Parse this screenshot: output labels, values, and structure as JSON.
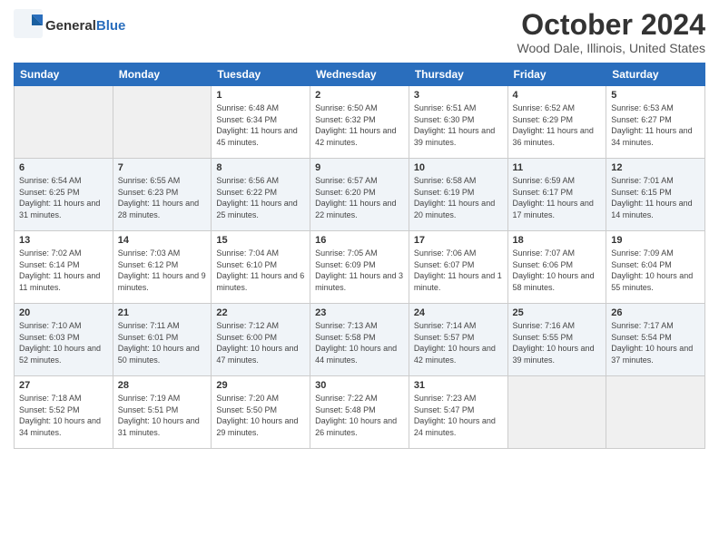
{
  "header": {
    "logo_general": "General",
    "logo_blue": "Blue",
    "month_title": "October 2024",
    "location": "Wood Dale, Illinois, United States"
  },
  "weekdays": [
    "Sunday",
    "Monday",
    "Tuesday",
    "Wednesday",
    "Thursday",
    "Friday",
    "Saturday"
  ],
  "weeks": [
    [
      {
        "day": "",
        "info": ""
      },
      {
        "day": "",
        "info": ""
      },
      {
        "day": "1",
        "info": "Sunrise: 6:48 AM\nSunset: 6:34 PM\nDaylight: 11 hours and 45 minutes."
      },
      {
        "day": "2",
        "info": "Sunrise: 6:50 AM\nSunset: 6:32 PM\nDaylight: 11 hours and 42 minutes."
      },
      {
        "day": "3",
        "info": "Sunrise: 6:51 AM\nSunset: 6:30 PM\nDaylight: 11 hours and 39 minutes."
      },
      {
        "day": "4",
        "info": "Sunrise: 6:52 AM\nSunset: 6:29 PM\nDaylight: 11 hours and 36 minutes."
      },
      {
        "day": "5",
        "info": "Sunrise: 6:53 AM\nSunset: 6:27 PM\nDaylight: 11 hours and 34 minutes."
      }
    ],
    [
      {
        "day": "6",
        "info": "Sunrise: 6:54 AM\nSunset: 6:25 PM\nDaylight: 11 hours and 31 minutes."
      },
      {
        "day": "7",
        "info": "Sunrise: 6:55 AM\nSunset: 6:23 PM\nDaylight: 11 hours and 28 minutes."
      },
      {
        "day": "8",
        "info": "Sunrise: 6:56 AM\nSunset: 6:22 PM\nDaylight: 11 hours and 25 minutes."
      },
      {
        "day": "9",
        "info": "Sunrise: 6:57 AM\nSunset: 6:20 PM\nDaylight: 11 hours and 22 minutes."
      },
      {
        "day": "10",
        "info": "Sunrise: 6:58 AM\nSunset: 6:19 PM\nDaylight: 11 hours and 20 minutes."
      },
      {
        "day": "11",
        "info": "Sunrise: 6:59 AM\nSunset: 6:17 PM\nDaylight: 11 hours and 17 minutes."
      },
      {
        "day": "12",
        "info": "Sunrise: 7:01 AM\nSunset: 6:15 PM\nDaylight: 11 hours and 14 minutes."
      }
    ],
    [
      {
        "day": "13",
        "info": "Sunrise: 7:02 AM\nSunset: 6:14 PM\nDaylight: 11 hours and 11 minutes."
      },
      {
        "day": "14",
        "info": "Sunrise: 7:03 AM\nSunset: 6:12 PM\nDaylight: 11 hours and 9 minutes."
      },
      {
        "day": "15",
        "info": "Sunrise: 7:04 AM\nSunset: 6:10 PM\nDaylight: 11 hours and 6 minutes."
      },
      {
        "day": "16",
        "info": "Sunrise: 7:05 AM\nSunset: 6:09 PM\nDaylight: 11 hours and 3 minutes."
      },
      {
        "day": "17",
        "info": "Sunrise: 7:06 AM\nSunset: 6:07 PM\nDaylight: 11 hours and 1 minute."
      },
      {
        "day": "18",
        "info": "Sunrise: 7:07 AM\nSunset: 6:06 PM\nDaylight: 10 hours and 58 minutes."
      },
      {
        "day": "19",
        "info": "Sunrise: 7:09 AM\nSunset: 6:04 PM\nDaylight: 10 hours and 55 minutes."
      }
    ],
    [
      {
        "day": "20",
        "info": "Sunrise: 7:10 AM\nSunset: 6:03 PM\nDaylight: 10 hours and 52 minutes."
      },
      {
        "day": "21",
        "info": "Sunrise: 7:11 AM\nSunset: 6:01 PM\nDaylight: 10 hours and 50 minutes."
      },
      {
        "day": "22",
        "info": "Sunrise: 7:12 AM\nSunset: 6:00 PM\nDaylight: 10 hours and 47 minutes."
      },
      {
        "day": "23",
        "info": "Sunrise: 7:13 AM\nSunset: 5:58 PM\nDaylight: 10 hours and 44 minutes."
      },
      {
        "day": "24",
        "info": "Sunrise: 7:14 AM\nSunset: 5:57 PM\nDaylight: 10 hours and 42 minutes."
      },
      {
        "day": "25",
        "info": "Sunrise: 7:16 AM\nSunset: 5:55 PM\nDaylight: 10 hours and 39 minutes."
      },
      {
        "day": "26",
        "info": "Sunrise: 7:17 AM\nSunset: 5:54 PM\nDaylight: 10 hours and 37 minutes."
      }
    ],
    [
      {
        "day": "27",
        "info": "Sunrise: 7:18 AM\nSunset: 5:52 PM\nDaylight: 10 hours and 34 minutes."
      },
      {
        "day": "28",
        "info": "Sunrise: 7:19 AM\nSunset: 5:51 PM\nDaylight: 10 hours and 31 minutes."
      },
      {
        "day": "29",
        "info": "Sunrise: 7:20 AM\nSunset: 5:50 PM\nDaylight: 10 hours and 29 minutes."
      },
      {
        "day": "30",
        "info": "Sunrise: 7:22 AM\nSunset: 5:48 PM\nDaylight: 10 hours and 26 minutes."
      },
      {
        "day": "31",
        "info": "Sunrise: 7:23 AM\nSunset: 5:47 PM\nDaylight: 10 hours and 24 minutes."
      },
      {
        "day": "",
        "info": ""
      },
      {
        "day": "",
        "info": ""
      }
    ]
  ]
}
